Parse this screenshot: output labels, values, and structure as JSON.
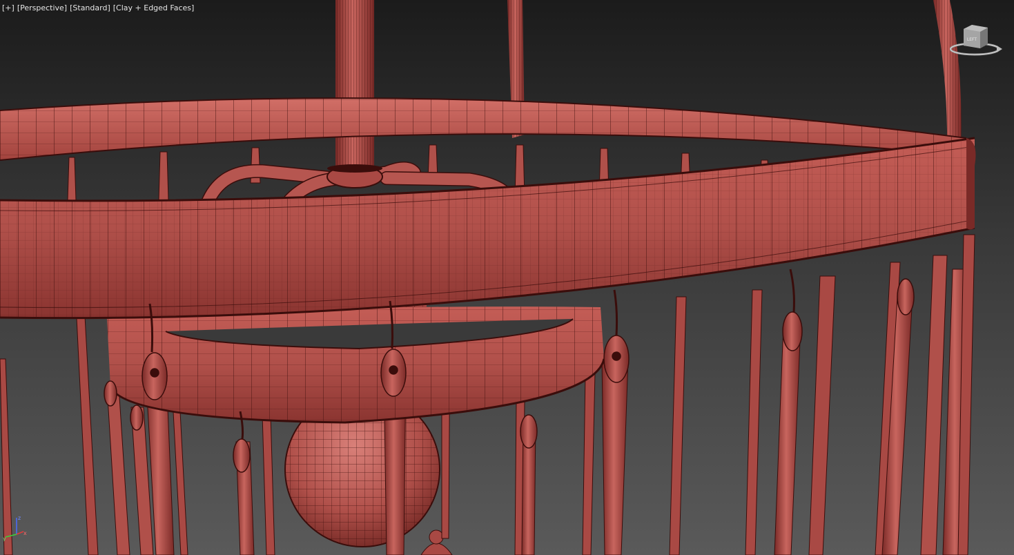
{
  "viewport": {
    "labels": [
      "[+]",
      "[Perspective]",
      "[Standard]",
      "[Clay + Edged Faces]"
    ]
  },
  "viewcube": {
    "face_label": "LEFT"
  },
  "axis_tripod": {
    "x": "x",
    "y": "y",
    "z": "z"
  },
  "scene": {
    "object": "chandelier-model",
    "material": "clay",
    "colors": {
      "clay": "#b4524c",
      "clay_dark": "#7a2a27",
      "clay_light": "#cd6f68",
      "wire": "#3a0d0b",
      "background_top": "#1b1b1b",
      "background_bottom": "#5a5a5a"
    }
  }
}
